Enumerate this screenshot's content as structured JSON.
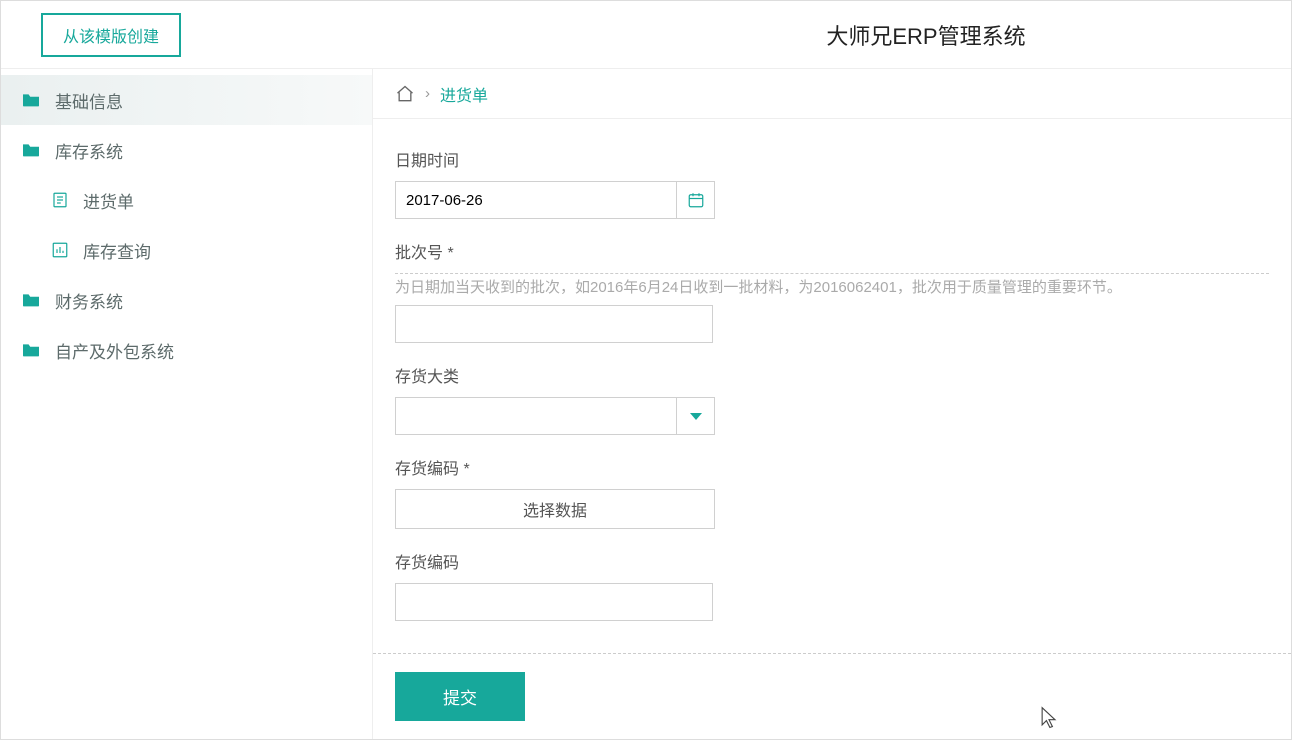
{
  "header": {
    "create_button": "从该模版创建",
    "app_title": "大师兄ERP管理系统"
  },
  "sidebar": {
    "items": [
      {
        "label": "基础信息",
        "type": "folder",
        "active": true
      },
      {
        "label": "库存系统",
        "type": "folder"
      },
      {
        "label": "进货单",
        "type": "doc",
        "sub": true
      },
      {
        "label": "库存查询",
        "type": "chart",
        "sub": true
      },
      {
        "label": "财务系统",
        "type": "folder"
      },
      {
        "label": "自产及外包系统",
        "type": "folder"
      }
    ]
  },
  "breadcrumb": {
    "current": "进货单"
  },
  "form": {
    "date_label": "日期时间",
    "date_value": "2017-06-26",
    "batch_label": "批次号 *",
    "batch_help": "为日期加当天收到的批次，如2016年6月24日收到一批材料，为2016062401，批次用于质量管理的重要环节。",
    "batch_value": "",
    "category_label": "存货大类",
    "category_value": "",
    "code1_label": "存货编码 *",
    "choose_data_label": "选择数据",
    "code2_label": "存货编码",
    "code2_value": "",
    "submit_label": "提交"
  }
}
